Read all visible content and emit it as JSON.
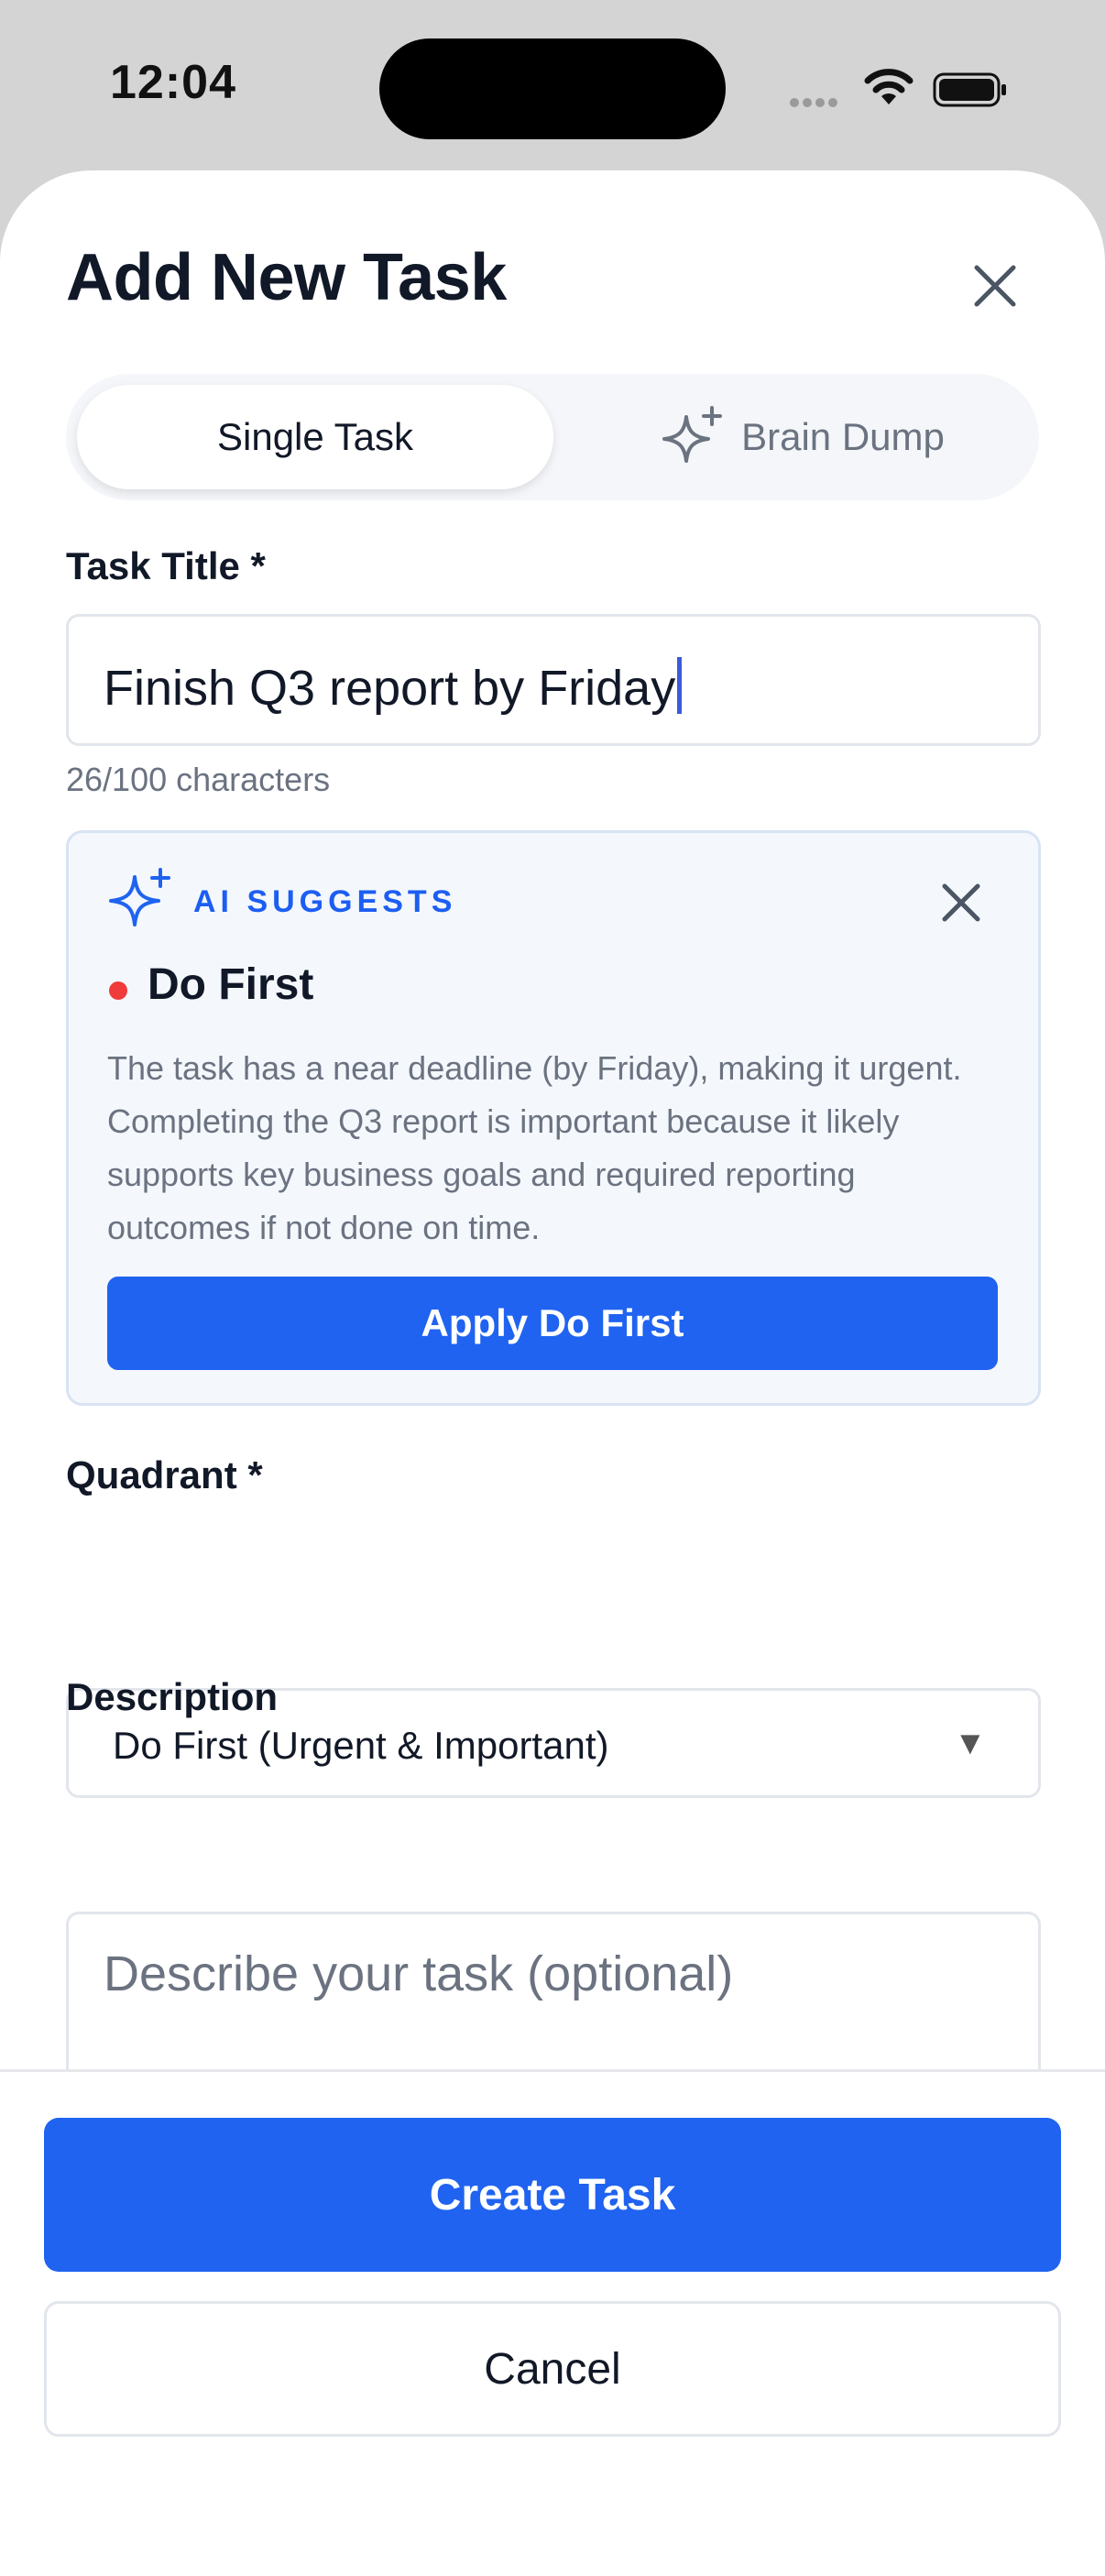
{
  "status_bar": {
    "time": "12:04"
  },
  "sheet": {
    "title": "Add New Task",
    "close_icon": "close-icon"
  },
  "tabs": [
    {
      "label": "Single Task",
      "selected": true
    },
    {
      "label": "Brain Dump",
      "selected": false,
      "icon": "sparkle-icon"
    }
  ],
  "task_title": {
    "label": "Task Title *",
    "value": "Finish Q3 report by Friday",
    "char_count": "26/100 characters"
  },
  "ai_suggestion": {
    "label": "AI SUGGESTS",
    "quadrant": "Do First",
    "reason": "The task has a near deadline (by Friday), making it urgent. Completing the Q3 report is important because it likely supports key business goals and required reporting outcomes if not done on time.",
    "apply_label": "Apply Do First",
    "accent": "#1f63f0",
    "dot_color": "#ef3b3b"
  },
  "quadrant": {
    "label": "Quadrant *",
    "selected": "Do First (Urgent & Important)"
  },
  "description": {
    "label": "Description",
    "placeholder": "Describe your task (optional)"
  },
  "footer": {
    "create_label": "Create Task",
    "cancel_label": "Cancel"
  }
}
